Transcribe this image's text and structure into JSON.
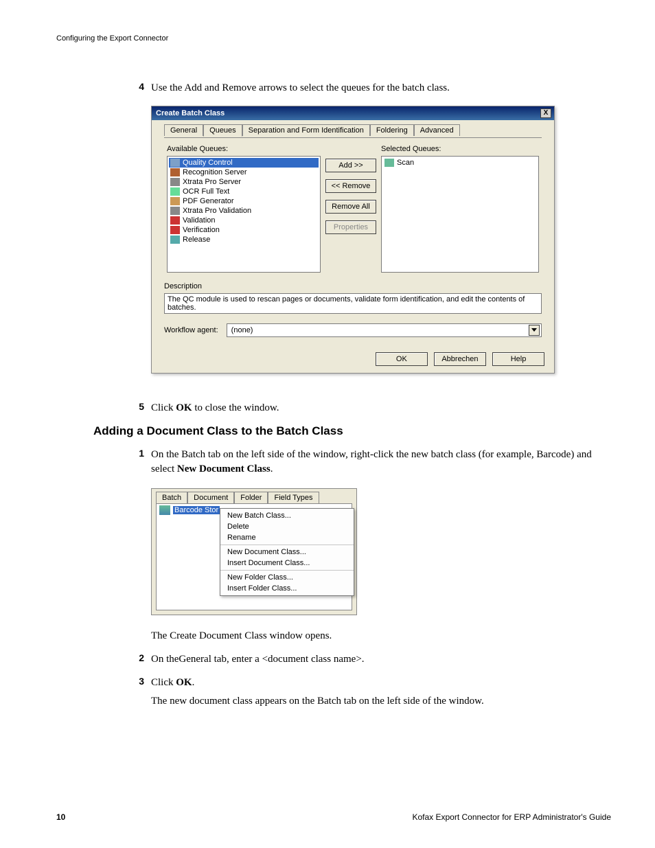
{
  "header_crumb": "Configuring the Export Connector",
  "step4": {
    "num": "4",
    "text_a": "Use the Add and Remove arrows to select the queues for the batch class."
  },
  "dlg1": {
    "title": "Create Batch Class",
    "close": "X",
    "tabs": [
      "General",
      "Queues",
      "Separation and Form Identification",
      "Foldering",
      "Advanced"
    ],
    "avail_label": "Available Queues:",
    "sel_label": "Selected Queues:",
    "available": [
      "Quality Control",
      "Recognition Server",
      "Xtrata Pro Server",
      "OCR Full Text",
      "PDF Generator",
      "Xtrata Pro Validation",
      "Validation",
      "Verification",
      "Release"
    ],
    "selected": [
      "Scan"
    ],
    "btn_add": "Add >>",
    "btn_remove": "<< Remove",
    "btn_removeall": "Remove All",
    "btn_props": "Properties",
    "desc_label": "Description",
    "desc_value": "The QC module is used to rescan pages or documents, validate form identification, and edit the contents of batches.",
    "wf_label": "Workflow agent:",
    "wf_value": "(none)",
    "ok": "OK",
    "cancel": "Abbrechen",
    "help": "Help"
  },
  "step5": {
    "num": "5",
    "pre": "Click ",
    "bold": "OK",
    "post": " to close the window."
  },
  "sect_title": "Adding a Document Class to the Batch Class",
  "step1": {
    "num": "1",
    "pre": "On the Batch tab on the left side of the window, right-click the new batch class (for example, Barcode) and select ",
    "bold": "New Document Class",
    "post": "."
  },
  "dlg2": {
    "tabs": [
      "Batch",
      "Document",
      "Folder",
      "Field Types"
    ],
    "tree_item": "Barcode Stor",
    "menu": {
      "g1": [
        "New Batch Class...",
        "Delete",
        "Rename"
      ],
      "g2": [
        "New Document Class...",
        "Insert Document Class..."
      ],
      "g3": [
        "New Folder Class...",
        "Insert Folder Class..."
      ]
    }
  },
  "para1": "The Create Document Class window opens.",
  "step2": {
    "num": "2",
    "text": "On theGeneral tab, enter a <document class name>."
  },
  "step3": {
    "num": "3",
    "pre": "Click ",
    "bold": "OK",
    "post": ".",
    "follow": "The new document class appears on the Batch tab on the left side of the window."
  },
  "footer": {
    "page": "10",
    "doc": "Kofax Export Connector for ERP Administrator's Guide"
  }
}
